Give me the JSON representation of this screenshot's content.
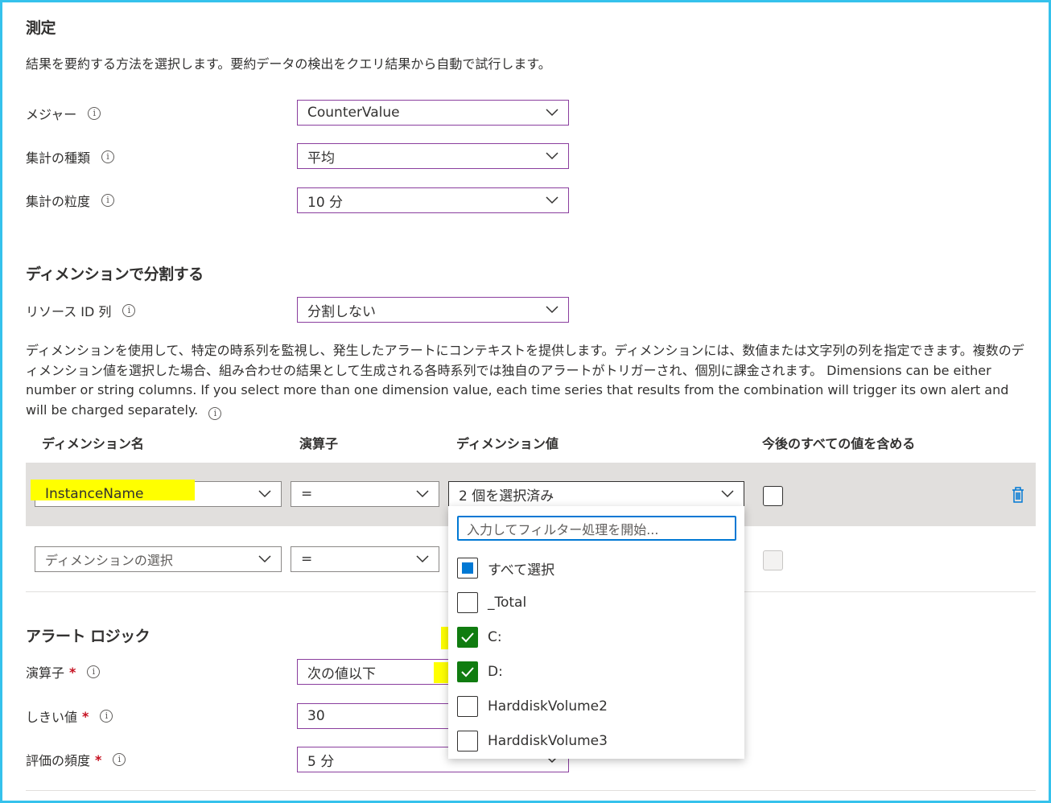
{
  "measurement": {
    "title": "測定",
    "description": "結果を要約する方法を選択します。要約データの検出をクエリ結果から自動で試行します。",
    "measure_label": "メジャー",
    "measure_value": "CounterValue",
    "aggregation_type_label": "集計の種類",
    "aggregation_type_value": "平均",
    "aggregation_granularity_label": "集計の粒度",
    "aggregation_granularity_value": "10 分"
  },
  "split": {
    "title": "ディメンションで分割する",
    "resource_id_label": "リソース ID 列",
    "resource_id_value": "分割しない",
    "description": "ディメンションを使用して、特定の時系列を監視し、発生したアラートにコンテキストを提供します。ディメンションには、数値または文字列の列を指定できます。複数のディメンション値を選択した場合、組み合わせの結果として生成される各時系列では独自のアラートがトリガーされ、個別に課金されます。 Dimensions can be either number or string columns. If you select more than one dimension value, each time series that results from the combination will trigger its own alert and will be charged separately."
  },
  "table": {
    "headers": [
      "ディメンション名",
      "演算子",
      "ディメンション値",
      "今後のすべての値を含める"
    ],
    "row1": {
      "name": "InstanceName",
      "operator": "=",
      "values": "2 個を選択済み"
    },
    "row2": {
      "name_placeholder": "ディメンションの選択",
      "operator": "="
    }
  },
  "dropdown_menu": {
    "filter_placeholder": "入力してフィルター処理を開始...",
    "options": [
      {
        "label": "すべて選択",
        "state": "partial"
      },
      {
        "label": "_Total",
        "state": "unchecked"
      },
      {
        "label": "C:",
        "state": "checked"
      },
      {
        "label": "D:",
        "state": "checked"
      },
      {
        "label": "HarddiskVolume2",
        "state": "unchecked"
      },
      {
        "label": "HarddiskVolume3",
        "state": "unchecked"
      }
    ]
  },
  "alert_logic": {
    "title": "アラート ロジック",
    "operator_label": "演算子",
    "operator_value": "次の値以下",
    "threshold_label": "しきい値",
    "threshold_value": "30",
    "frequency_label": "評価の頻度",
    "frequency_value": "5 分",
    "required_mark": "*"
  },
  "icons": {
    "info": "i"
  },
  "colors": {
    "accent": "#0078d4",
    "checked": "#107c10",
    "dropdown_border": "#8a3e9e",
    "highlight": "#ffff00",
    "frame": "#35c2ec"
  }
}
